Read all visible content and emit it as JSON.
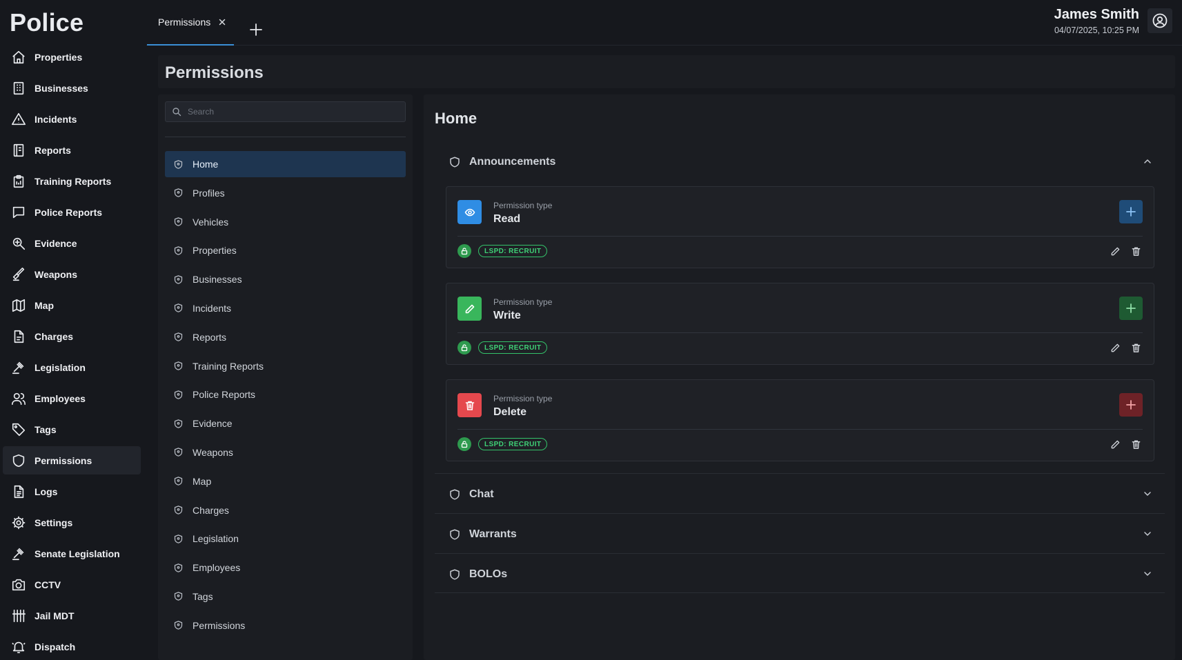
{
  "app": {
    "brand": "Police"
  },
  "nav": {
    "items": [
      {
        "label": "Properties",
        "icon": "home-icon"
      },
      {
        "label": "Businesses",
        "icon": "building-icon"
      },
      {
        "label": "Incidents",
        "icon": "warning-icon"
      },
      {
        "label": "Reports",
        "icon": "book-icon"
      },
      {
        "label": "Training Reports",
        "icon": "clipboard-icon"
      },
      {
        "label": "Police Reports",
        "icon": "message-icon"
      },
      {
        "label": "Evidence",
        "icon": "magnifier-icon"
      },
      {
        "label": "Weapons",
        "icon": "weapon-icon"
      },
      {
        "label": "Map",
        "icon": "map-icon"
      },
      {
        "label": "Charges",
        "icon": "document-icon"
      },
      {
        "label": "Legislation",
        "icon": "gavel-icon"
      },
      {
        "label": "Employees",
        "icon": "users-icon"
      },
      {
        "label": "Tags",
        "icon": "tag-icon"
      },
      {
        "label": "Permissions",
        "icon": "shield-icon"
      },
      {
        "label": "Logs",
        "icon": "file-text-icon"
      },
      {
        "label": "Settings",
        "icon": "gear-icon"
      },
      {
        "label": "Senate Legislation",
        "icon": "gavel-icon"
      },
      {
        "label": "CCTV",
        "icon": "camera-icon"
      },
      {
        "label": "Jail MDT",
        "icon": "jail-icon"
      },
      {
        "label": "Dispatch",
        "icon": "bell-icon"
      }
    ],
    "active": "Permissions"
  },
  "tabs": [
    {
      "label": "Permissions"
    }
  ],
  "user": {
    "name": "James Smith",
    "datetime": "04/07/2025, 10:25 PM"
  },
  "page": {
    "title": "Permissions"
  },
  "search": {
    "placeholder": "Search",
    "value": ""
  },
  "permission_pages": [
    "Home",
    "Profiles",
    "Vehicles",
    "Properties",
    "Businesses",
    "Incidents",
    "Reports",
    "Training Reports",
    "Police Reports",
    "Evidence",
    "Weapons",
    "Map",
    "Charges",
    "Legislation",
    "Employees",
    "Tags",
    "Permissions"
  ],
  "selected_page": "Home",
  "detail": {
    "title": "Home",
    "sections": [
      {
        "label": "Announcements",
        "expanded": true,
        "permissions": [
          {
            "type_caption": "Permission type",
            "type": "Read",
            "icon": "eye-icon",
            "color": "#2f8de4",
            "add_bg": "#1f4c78",
            "role": "LSPD: RECRUIT"
          },
          {
            "type_caption": "Permission type",
            "type": "Write",
            "icon": "pencil-icon",
            "color": "#39b65c",
            "add_bg": "#1e5a32",
            "role": "LSPD: RECRUIT"
          },
          {
            "type_caption": "Permission type",
            "type": "Delete",
            "icon": "trash-icon",
            "color": "#e5484d",
            "add_bg": "#6e2227",
            "role": "LSPD: RECRUIT"
          }
        ]
      },
      {
        "label": "Chat",
        "expanded": false
      },
      {
        "label": "Warrants",
        "expanded": false
      },
      {
        "label": "BOLOs",
        "expanded": false
      }
    ]
  }
}
